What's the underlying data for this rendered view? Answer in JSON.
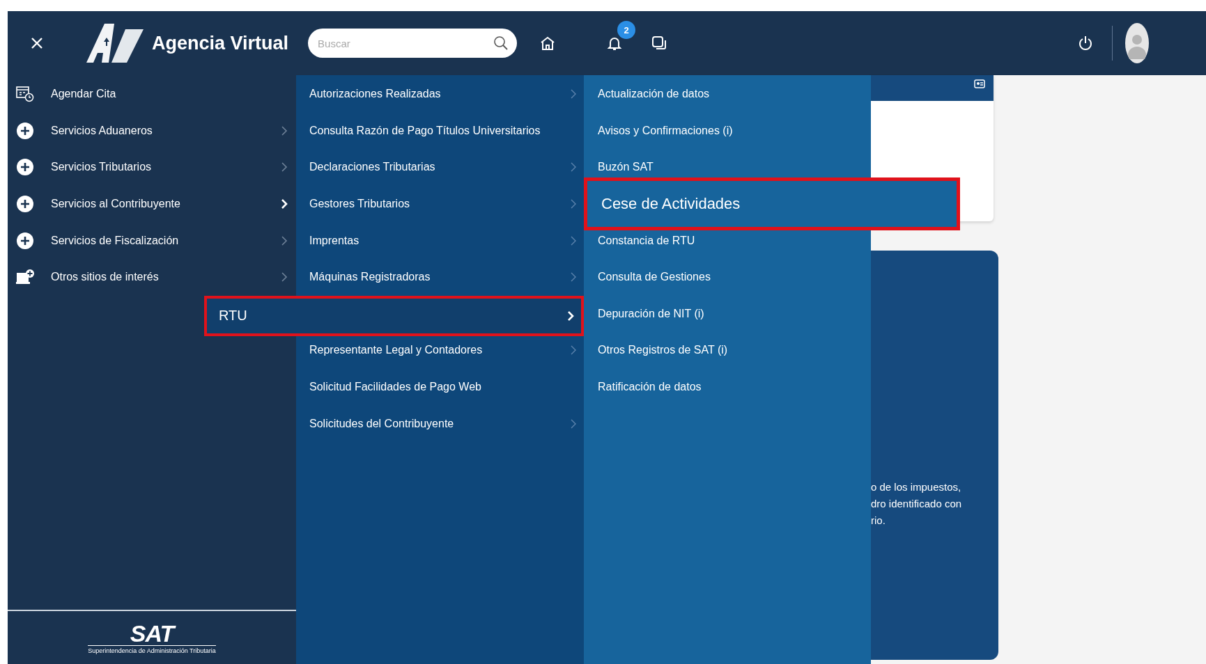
{
  "header": {
    "logo_text": "Agencia Virtual",
    "search": {
      "placeholder": "Buscar"
    },
    "notification_count": "2"
  },
  "menu": {
    "level_1": [
      {
        "label": "Agendar Cita",
        "kind": "calendar",
        "has_arrow": false,
        "expanded": false
      },
      {
        "label": "Servicios Aduaneros",
        "kind": "plus",
        "has_arrow": true,
        "expanded": false
      },
      {
        "label": "Servicios Tributarios",
        "kind": "plus",
        "has_arrow": true,
        "expanded": false
      },
      {
        "label": "Servicios al Contribuyente",
        "kind": "plus",
        "has_arrow": true,
        "expanded": true
      },
      {
        "label": "Servicios de Fiscalización",
        "kind": "plus",
        "has_arrow": true,
        "expanded": false
      },
      {
        "label": "Otros sitios de interés",
        "kind": "monitor",
        "has_arrow": true,
        "expanded": false
      }
    ],
    "level_2": [
      {
        "label": "Autorizaciones Realizadas",
        "has_arrow": true,
        "selected": false
      },
      {
        "label": "Consulta Razón de Pago Títulos Universitarios",
        "has_arrow": false,
        "selected": false
      },
      {
        "label": "Declaraciones Tributarias",
        "has_arrow": true,
        "selected": false
      },
      {
        "label": "Gestores Tributarios",
        "has_arrow": true,
        "selected": false
      },
      {
        "label": "Imprentas",
        "has_arrow": true,
        "selected": false
      },
      {
        "label": "Máquinas Registradoras",
        "has_arrow": true,
        "selected": false
      },
      {
        "label": "RTU",
        "has_arrow": true,
        "selected": true
      },
      {
        "label": "Representante Legal y Contadores",
        "has_arrow": true,
        "selected": false
      },
      {
        "label": "Solicitud Facilidades de Pago Web",
        "has_arrow": false,
        "selected": false
      },
      {
        "label": "Solicitudes del Contribuyente",
        "has_arrow": true,
        "selected": false
      }
    ],
    "level_3": [
      {
        "label": "Actualización de datos",
        "selected": false
      },
      {
        "label": "Avisos y Confirmaciones (i)",
        "selected": false
      },
      {
        "label": "Buzón SAT",
        "selected": false
      },
      {
        "label": "Cese de Actividades",
        "selected": true
      },
      {
        "label": "Constancia de RTU",
        "selected": false
      },
      {
        "label": "Consulta de Gestiones",
        "selected": false
      },
      {
        "label": "Depuración de NIT (i)",
        "selected": false
      },
      {
        "label": "Otros Registros de SAT (i)",
        "selected": false
      },
      {
        "label": "Ratificación de datos",
        "selected": false
      }
    ]
  },
  "footer_logo": {
    "name": "SAT",
    "subtitle": "Superintendencia de Administración Tributaria"
  },
  "background_card": {
    "lines": [
      "o de los impuestos,",
      "dro identificado con",
      "rio."
    ]
  }
}
